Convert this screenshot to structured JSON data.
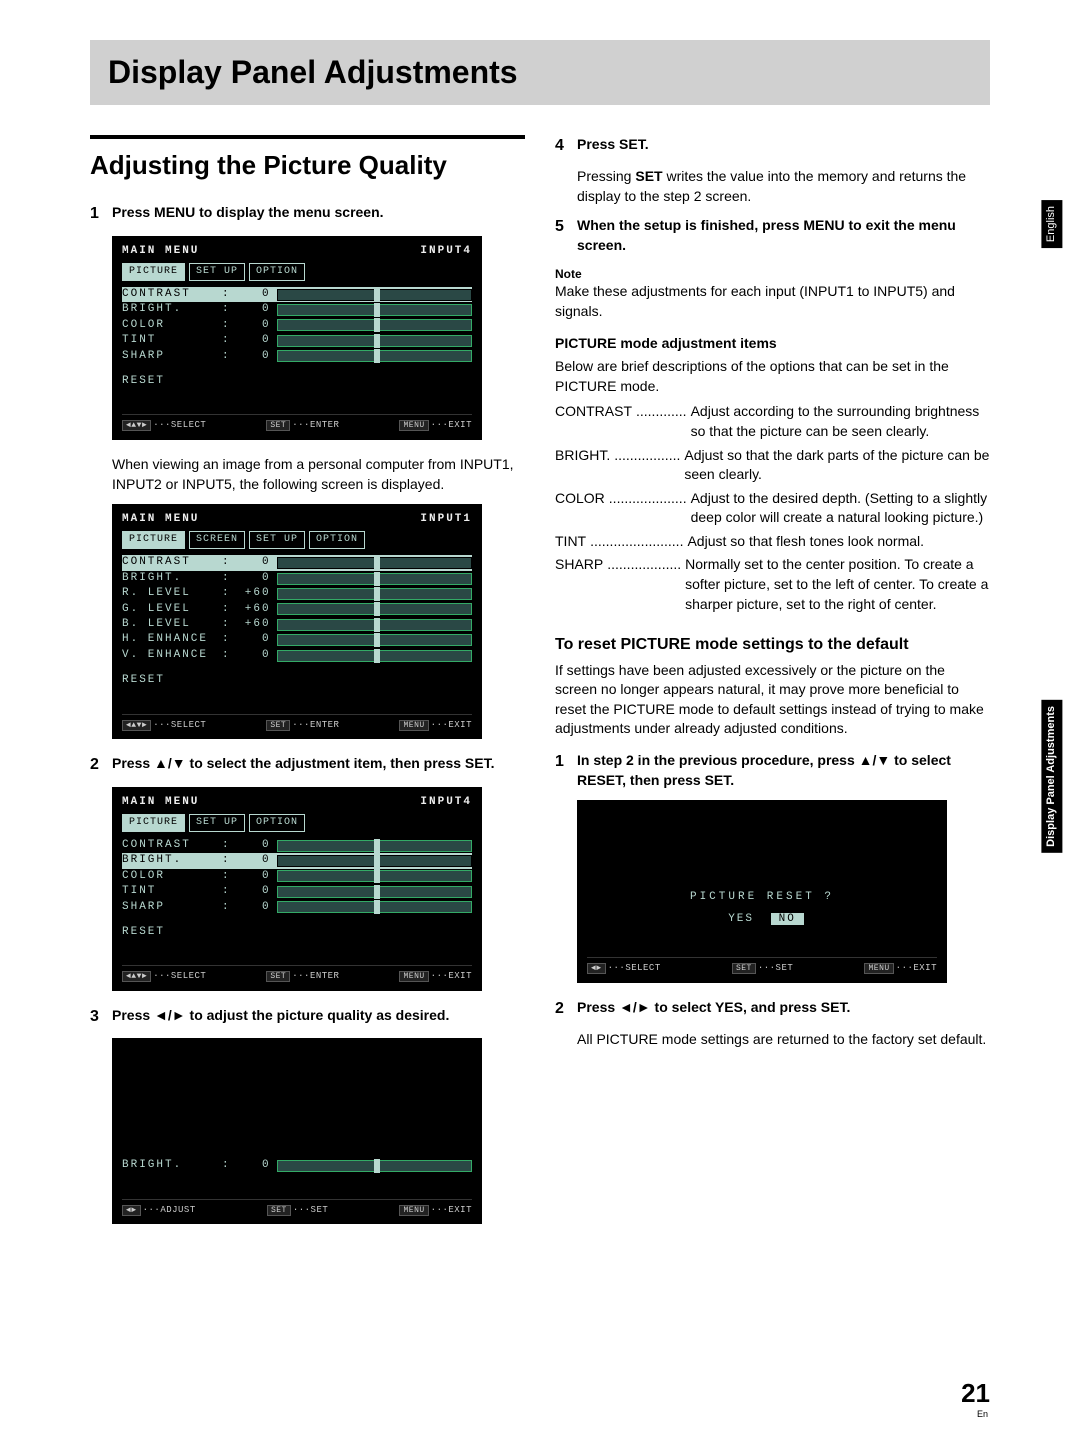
{
  "page": {
    "title": "Display Panel Adjustments",
    "section": "Adjusting the Picture Quality",
    "number": "21",
    "lang_short": "En"
  },
  "side_tabs": {
    "lang": "English",
    "chapter": "Display Panel Adjustments"
  },
  "steps_left": {
    "s1": {
      "num": "1",
      "text": "Press MENU to display the menu screen.",
      "body": "When viewing an image from a personal computer from INPUT1, INPUT2 or INPUT5, the following screen is displayed."
    },
    "s2": {
      "num": "2",
      "text": "Press ▲/▼ to select the adjustment item, then press SET."
    },
    "s3": {
      "num": "3",
      "text": "Press ◄/► to adjust the picture quality as desired."
    }
  },
  "steps_right": {
    "s4": {
      "num": "4",
      "text": "Press SET.",
      "body_a": "Pressing ",
      "body_b": "SET",
      "body_c": " writes the value into the memory and returns the display to the step 2 screen."
    },
    "s5": {
      "num": "5",
      "text": "When the setup is finished, press MENU to exit the menu screen."
    },
    "note_label": "Note",
    "note_body": "Make these adjustments for each input (INPUT1 to INPUT5) and signals.",
    "items_hdr": "PICTURE mode adjustment items",
    "items_intro": "Below are brief descriptions of the options that can be set in the PICTURE mode.",
    "reset_hdr": "To reset PICTURE mode settings to the default",
    "reset_intro": "If settings have been adjusted excessively or the picture on the screen no longer appears natural, it may prove more beneficial to reset the PICTURE mode to default settings instead of trying to make adjustments under already adjusted conditions.",
    "r1": {
      "num": "1",
      "text": "In step 2 in the previous procedure, press ▲/▼ to select RESET, then press SET."
    },
    "r2": {
      "num": "2",
      "text": "Press ◄/► to select YES, and press SET.",
      "body": "All PICTURE mode settings are returned to the factory set default."
    }
  },
  "defs": {
    "contrast": {
      "term": "CONTRAST",
      "dots": ".............",
      "desc": "Adjust according to the surrounding brightness so that the picture can be seen clearly."
    },
    "bright": {
      "term": "BRIGHT.",
      "dots": ".................",
      "desc": "Adjust so that the dark parts of the picture can be seen clearly."
    },
    "color": {
      "term": "COLOR",
      "dots": "....................",
      "desc": "Adjust to the desired depth. (Setting to a slightly deep color will create a natural looking picture.)"
    },
    "tint": {
      "term": "TINT",
      "dots": "........................",
      "desc": "Adjust so that flesh tones look normal."
    },
    "sharp": {
      "term": "SHARP",
      "dots": "...................",
      "desc": "Normally set to the center position. To create a softer picture, set to the left of center. To create a sharper picture, set to the right of center."
    }
  },
  "osd": {
    "main_menu": "MAIN MENU",
    "input4": "INPUT4",
    "input1": "INPUT1",
    "tabs": {
      "picture": "PICTURE",
      "screen": "SCREEN",
      "setup": "SET UP",
      "option": "OPTION"
    },
    "rows1": [
      {
        "label": "CONTRAST",
        "val": "0"
      },
      {
        "label": "BRIGHT.",
        "val": "0"
      },
      {
        "label": "COLOR",
        "val": "0"
      },
      {
        "label": "TINT",
        "val": "0"
      },
      {
        "label": "SHARP",
        "val": "0"
      }
    ],
    "rows2": [
      {
        "label": "CONTRAST",
        "val": "0"
      },
      {
        "label": "BRIGHT.",
        "val": "0"
      },
      {
        "label": "R. LEVEL",
        "val": "+60"
      },
      {
        "label": "G. LEVEL",
        "val": "+60"
      },
      {
        "label": "B. LEVEL",
        "val": "+60"
      },
      {
        "label": "H. ENHANCE",
        "val": "0"
      },
      {
        "label": "V. ENHANCE",
        "val": "0"
      }
    ],
    "reset": "RESET",
    "adjust_label": "BRIGHT.",
    "adjust_val": "0",
    "reset_q": "PICTURE  RESET ?",
    "yes": "YES",
    "no": "NO",
    "foot": {
      "select": "SELECT",
      "adjust": "ADJUST",
      "enter": "ENTER",
      "set": "SET",
      "exit": "EXIT",
      "key_nav": "◄▲▼►",
      "key_lr": "◄►",
      "key_set": "SET",
      "key_menu": "MENU"
    }
  }
}
